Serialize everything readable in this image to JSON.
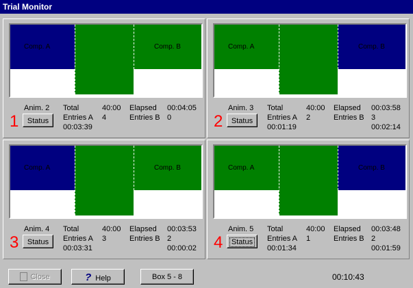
{
  "window": {
    "title": "Trial Monitor"
  },
  "panels": [
    {
      "box_number": "1",
      "animal": "Anim. 2",
      "status_label": "Status",
      "total_label": "Total",
      "total_value": "40:00",
      "elapsed_label": "Elapsed",
      "elapsed_value": "00:04:05",
      "entries_a_label": "Entries A",
      "entries_a_value": "4",
      "time_a": "00:03:39",
      "entries_b_label": "Entries B",
      "entries_b_value": "0",
      "time_b": "",
      "comp_a_label": "Comp. A",
      "comp_b_label": "Comp. B",
      "focused": false
    },
    {
      "box_number": "2",
      "animal": "Anim. 3",
      "status_label": "Status",
      "total_label": "Total",
      "total_value": "40:00",
      "elapsed_label": "Elapsed",
      "elapsed_value": "00:03:58",
      "entries_a_label": "Entries A",
      "entries_a_value": "2",
      "time_a": "00:01:19",
      "entries_b_label": "Entries B",
      "entries_b_value": "3",
      "time_b": "00:02:14",
      "comp_a_label": "Comp. A",
      "comp_b_label": "Comp. B",
      "focused": false
    },
    {
      "box_number": "3",
      "animal": "Anim. 4",
      "status_label": "Status",
      "total_label": "Total",
      "total_value": "40:00",
      "elapsed_label": "Elapsed",
      "elapsed_value": "00:03:53",
      "entries_a_label": "Entries A",
      "entries_a_value": "3",
      "time_a": "00:03:31",
      "entries_b_label": "Entries B",
      "entries_b_value": "2",
      "time_b": "00:00:02",
      "comp_a_label": "Comp. A",
      "comp_b_label": "Comp. B",
      "focused": false
    },
    {
      "box_number": "4",
      "animal": "Anim. 5",
      "status_label": "Status",
      "total_label": "Total",
      "total_value": "40:00",
      "elapsed_label": "Elapsed",
      "elapsed_value": "00:03:48",
      "entries_a_label": "Entries A",
      "entries_a_value": "1",
      "time_a": "00:01:34",
      "entries_b_label": "Entries B",
      "entries_b_value": "2",
      "time_b": "00:01:59",
      "comp_a_label": "Comp. A",
      "comp_b_label": "Comp. B",
      "focused": true
    }
  ],
  "colors": {
    "compartment_a": "#000080",
    "center": "#008000",
    "compartment_b": "#000080",
    "box_number": "#ff0000"
  },
  "footer": {
    "close_label": "Close",
    "close_icon": "door-icon",
    "close_enabled": false,
    "help_label": "Help",
    "help_icon": "question-mark-icon",
    "box_label": "Box 5 - 8",
    "session_timer": "00:10:43"
  }
}
